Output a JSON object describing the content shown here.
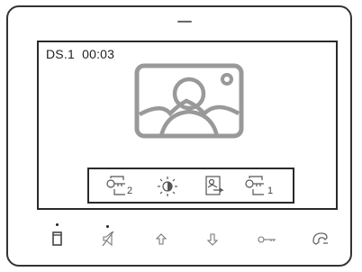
{
  "screen": {
    "status": {
      "channel": "DS.1",
      "timer": "00:03"
    },
    "image_placeholder_icon": "image-placeholder-icon"
  },
  "toolbar": {
    "items": [
      {
        "name": "unlock-lock-2",
        "icon": "key-icon",
        "sub": "2"
      },
      {
        "name": "brightness",
        "icon": "brightness-icon"
      },
      {
        "name": "snapshot",
        "icon": "snapshot-icon"
      },
      {
        "name": "unlock-lock-1",
        "icon": "key-icon",
        "sub": "1"
      }
    ]
  },
  "hardware_buttons": [
    {
      "name": "monitor",
      "icon": "handset-icon",
      "indicator": true
    },
    {
      "name": "mute",
      "icon": "speaker-mute-icon",
      "indicator": true
    },
    {
      "name": "up",
      "icon": "arrow-up-icon"
    },
    {
      "name": "down",
      "icon": "arrow-down-icon"
    },
    {
      "name": "unlock",
      "icon": "key-icon"
    },
    {
      "name": "intercom",
      "icon": "intercom-icon"
    }
  ]
}
